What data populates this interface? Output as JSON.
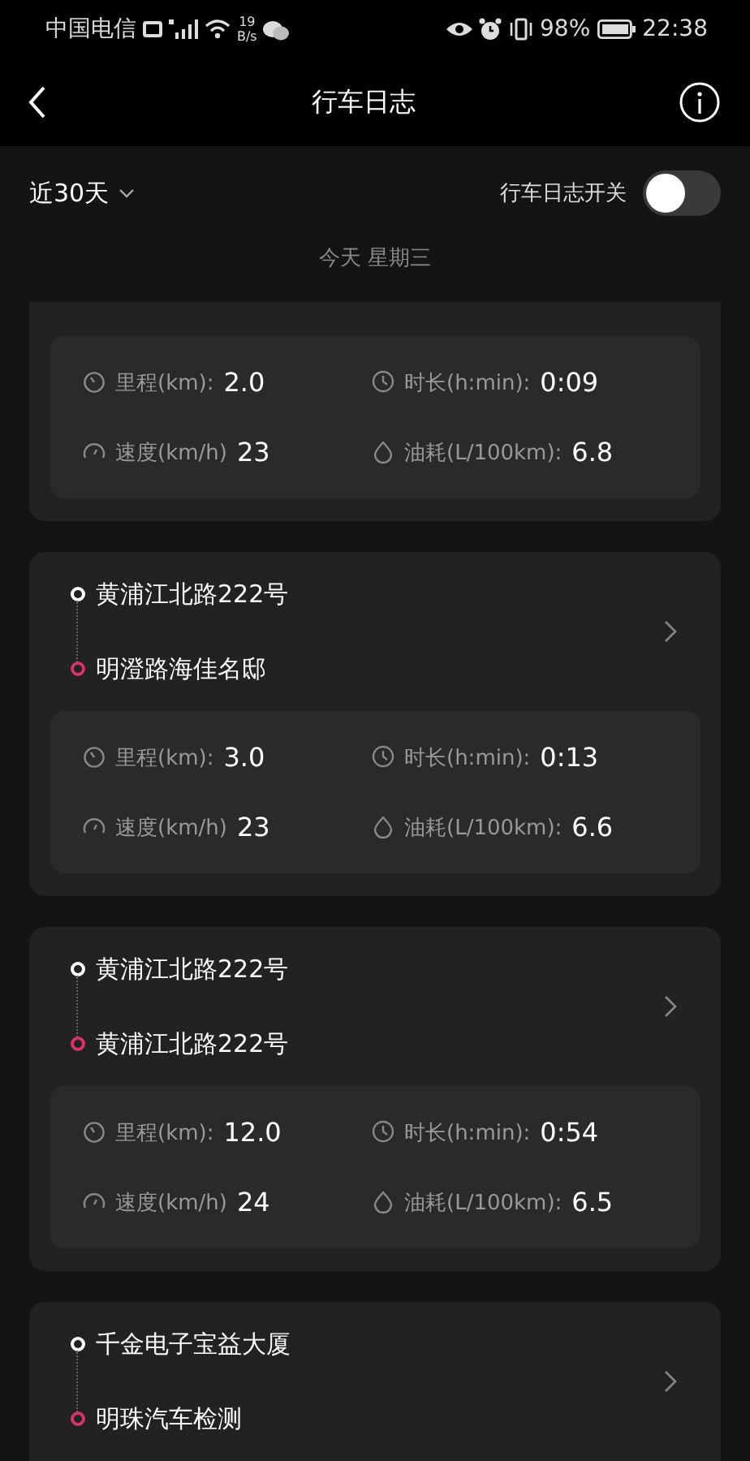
{
  "status_bar": {
    "carrier": "中国电信",
    "net_speed": "19",
    "net_unit": "B/s",
    "battery": "98%",
    "time": "22:38"
  },
  "header": {
    "title": "行车日志"
  },
  "filter": {
    "period": "近30天",
    "switch_label": "行车日志开关",
    "on": false
  },
  "date_label": "今天 星期三",
  "trips": [
    {
      "stats": [
        {
          "kind": "distance",
          "label": "里程(km):",
          "value": "2.0"
        },
        {
          "kind": "duration",
          "label": "时长(h:min):",
          "value": "0:09"
        },
        {
          "kind": "speed",
          "label": "速度(km/h)",
          "value": "23"
        },
        {
          "kind": "fuel",
          "label": "油耗(L/100km):",
          "value": "6.8"
        }
      ]
    },
    {
      "start": "黄浦江北路222号",
      "end": "明澄路海佳名邸",
      "stats": [
        {
          "kind": "distance",
          "label": "里程(km):",
          "value": "3.0"
        },
        {
          "kind": "duration",
          "label": "时长(h:min):",
          "value": "0:13"
        },
        {
          "kind": "speed",
          "label": "速度(km/h)",
          "value": "23"
        },
        {
          "kind": "fuel",
          "label": "油耗(L/100km):",
          "value": "6.6"
        }
      ]
    },
    {
      "start": "黄浦江北路222号",
      "end": "黄浦江北路222号",
      "stats": [
        {
          "kind": "distance",
          "label": "里程(km):",
          "value": "12.0"
        },
        {
          "kind": "duration",
          "label": "时长(h:min):",
          "value": "0:54"
        },
        {
          "kind": "speed",
          "label": "速度(km/h)",
          "value": "24"
        },
        {
          "kind": "fuel",
          "label": "油耗(L/100km):",
          "value": "6.5"
        }
      ]
    },
    {
      "start": "千金电子宝益大厦",
      "end": "明珠汽车检测"
    }
  ]
}
